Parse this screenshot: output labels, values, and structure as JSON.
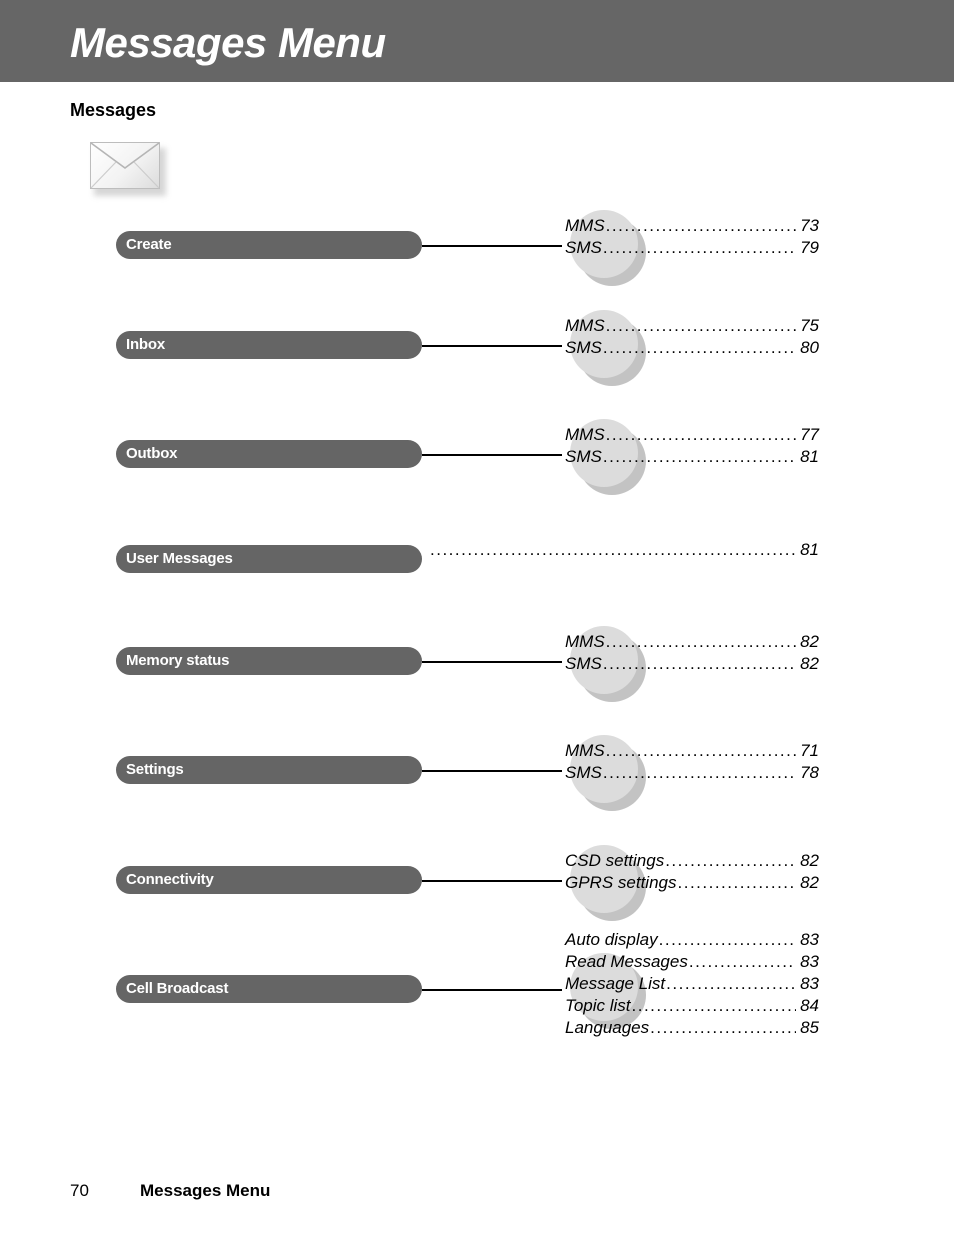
{
  "header": {
    "title": "Messages Menu",
    "band_color": "#666666",
    "title_color": "#ffffff"
  },
  "section": {
    "title": "Messages",
    "icon": "envelope-icon"
  },
  "theme": {
    "pill_color": "#656565",
    "pill_text_color": "#ffffff",
    "sphere_color": "#dcdcdc",
    "sphere_shadow_color": "#c3c3c3",
    "connector_color": "#000000"
  },
  "rows": [
    {
      "label": "Create",
      "has_sphere": true,
      "has_connector": true,
      "entries": [
        {
          "label": "MMS",
          "page": "73"
        },
        {
          "label": "SMS",
          "page": "79"
        }
      ]
    },
    {
      "label": "Inbox",
      "has_sphere": true,
      "has_connector": true,
      "entries": [
        {
          "label": "MMS",
          "page": "75"
        },
        {
          "label": "SMS",
          "page": "80"
        }
      ]
    },
    {
      "label": "Outbox",
      "has_sphere": true,
      "has_connector": true,
      "entries": [
        {
          "label": "MMS",
          "page": "77"
        },
        {
          "label": "SMS",
          "page": "81"
        }
      ]
    },
    {
      "label": "User Messages",
      "has_sphere": false,
      "has_connector": false,
      "entries": [
        {
          "label": "",
          "page": "81"
        }
      ]
    },
    {
      "label": "Memory status",
      "has_sphere": true,
      "has_connector": true,
      "entries": [
        {
          "label": "MMS",
          "page": "82"
        },
        {
          "label": "SMS",
          "page": "82"
        }
      ]
    },
    {
      "label": "Settings",
      "has_sphere": true,
      "has_connector": true,
      "entries": [
        {
          "label": "MMS",
          "page": "71"
        },
        {
          "label": "SMS",
          "page": "78"
        }
      ]
    },
    {
      "label": "Connectivity",
      "has_sphere": true,
      "has_connector": true,
      "entries": [
        {
          "label": "CSD settings",
          "page": "82"
        },
        {
          "label": "GPRS settings",
          "page": "82"
        }
      ]
    },
    {
      "label": "Cell Broadcast",
      "has_sphere": true,
      "has_connector": true,
      "entries": [
        {
          "label": "Auto display",
          "page": "83"
        },
        {
          "label": "Read Messages",
          "page": "83"
        },
        {
          "label": "Message List",
          "page": "83"
        },
        {
          "label": "Topic list",
          "page": "84"
        },
        {
          "label": "Languages",
          "page": "85"
        }
      ]
    }
  ],
  "footer": {
    "page_number": "70",
    "title": "Messages Menu"
  }
}
